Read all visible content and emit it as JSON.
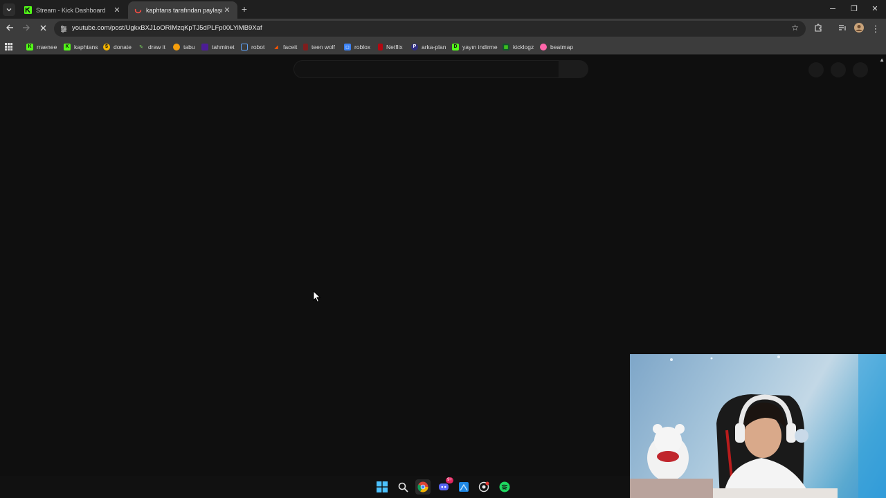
{
  "browser": {
    "tabs": [
      {
        "title": "Stream - Kick Dashboard",
        "favicon": "kick-icon",
        "active": false
      },
      {
        "title": "kaphtans tarafından paylaşılan",
        "favicon": "youtube-loading-icon",
        "active": true
      }
    ],
    "address": {
      "url": "youtube.com/post/UgkxBXJ1oORIMzqKpTJ5dPLFp00LYiMB9Xaf"
    },
    "bookmarks": [
      {
        "label": "rraenee",
        "icon": "kick-icon",
        "color": "#53fc18"
      },
      {
        "label": "kaphtans",
        "icon": "kick-icon",
        "color": "#53fc18"
      },
      {
        "label": "donate",
        "icon": "donate-icon",
        "color": "#f4b400"
      },
      {
        "label": "draw it",
        "icon": "draw-icon",
        "color": "#7bd35f"
      },
      {
        "label": "tabu",
        "icon": "tabu-icon",
        "color": "#f59e0b"
      },
      {
        "label": "tahminet",
        "icon": "tahminet-icon",
        "color": "#7c3aed"
      },
      {
        "label": "robot",
        "icon": "robot-icon",
        "color": "#60a5fa"
      },
      {
        "label": "faceit",
        "icon": "faceit-icon",
        "color": "#ff5500"
      },
      {
        "label": "teen wolf",
        "icon": "teen-wolf-icon",
        "color": "#b91c1c"
      },
      {
        "label": "roblox",
        "icon": "roblox-icon",
        "color": "#3b82f6"
      },
      {
        "label": "Netflix",
        "icon": "netflix-icon",
        "color": "#e50914"
      },
      {
        "label": "arka-plan",
        "icon": "arka-plan-icon",
        "color": "#6d28d9"
      },
      {
        "label": "yayın indirme",
        "icon": "download-icon",
        "color": "#53fc18"
      },
      {
        "label": "kicklogz",
        "icon": "kicklogz-icon",
        "color": "#22c55e"
      },
      {
        "label": "beatmap",
        "icon": "osu-icon",
        "color": "#ff66aa"
      }
    ]
  },
  "taskbar": {
    "icons": [
      "windows-start-icon",
      "search-icon",
      "chrome-icon",
      "discord-icon",
      "app-icon",
      "osu-icon",
      "spotify-icon"
    ],
    "discord_badge": "9+"
  }
}
